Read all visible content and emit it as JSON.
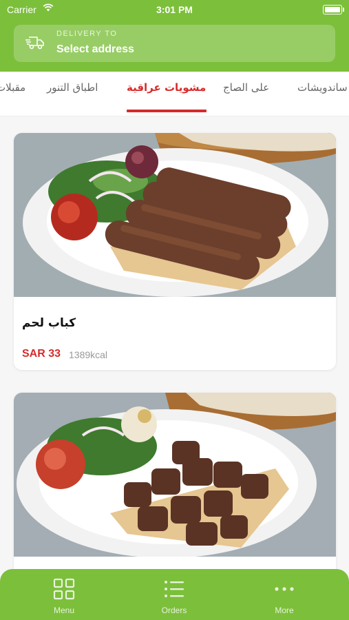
{
  "status_bar": {
    "carrier": "Carrier",
    "time": "3:01 PM"
  },
  "delivery": {
    "label": "DELIVERY TO",
    "value": "Select address",
    "icon": "truck-icon"
  },
  "tabs": [
    {
      "label": "مقبلات"
    },
    {
      "label": "اطباق التنور"
    },
    {
      "label": "مشويات عراقية",
      "active": true
    },
    {
      "label": "على الصاج"
    },
    {
      "label": "ساندويشات"
    }
  ],
  "items": [
    {
      "name": "كباب لحم",
      "price": "SAR 33",
      "kcal": "1389kcal",
      "image": "kebab-plate-image"
    },
    {
      "name": "",
      "price": "",
      "kcal": "",
      "image": "tikka-plate-image"
    }
  ],
  "nav": [
    {
      "label": "Menu",
      "icon": "grid-icon"
    },
    {
      "label": "Orders",
      "icon": "list-icon"
    },
    {
      "label": "More",
      "icon": "more-icon"
    }
  ],
  "colors": {
    "brand_green": "#7cbf3b",
    "accent_red": "#d72a2a"
  }
}
